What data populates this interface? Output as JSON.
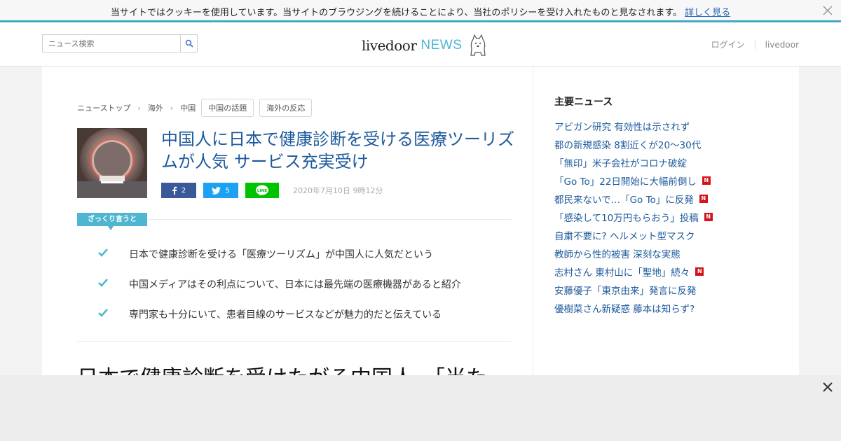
{
  "cookie": {
    "text": "当サイトではクッキーを使用しています。当サイトのブラウジングを続けることにより、当社のポリシーを受け入れたものと見なされます。",
    "link": "詳しく見る"
  },
  "header": {
    "search_placeholder": "ニュース検索",
    "logo_main": "livedoor",
    "logo_sub": "NEWS",
    "login": "ログイン",
    "livedoor": "livedoor"
  },
  "breadcrumb": [
    "ニューストップ",
    "海外",
    "中国"
  ],
  "tags": [
    "中国の話題",
    "海外の反応"
  ],
  "article": {
    "title": "中国人に日本で健康診断を受ける医療ツーリズムが人気 サービス充実受け",
    "facebook_count": "2",
    "twitter_count": "5",
    "date": "2020年7月10日 9時12分",
    "summary_label": "ざっくり言うと",
    "points": [
      "日本で健康診断を受ける「医療ツーリズム」が中国人に人気だという",
      "中国メディアはその利点について、日本には最先端の医療機器があると紹介",
      "専門家も十分にいて、患者目線のサービスなどが魅力的だと伝えている"
    ],
    "headline": "日本で健康診断を受けたがる中国人、「当た"
  },
  "sidebar": {
    "heading": "主要ニュース",
    "items": [
      {
        "text": "アビガン研究 有効性は示されず",
        "new": false
      },
      {
        "text": "都の新規感染 8割近くが20～30代",
        "new": false
      },
      {
        "text": "「無印」米子会社がコロナ破綻",
        "new": false
      },
      {
        "text": "「Go To」22日開始に大幅前倒し",
        "new": true
      },
      {
        "text": "都民来ないで…「Go To」に反発",
        "new": true
      },
      {
        "text": "「感染して10万円もらおう」投稿",
        "new": true
      },
      {
        "text": "自粛不要に? ヘルメット型マスク",
        "new": false
      },
      {
        "text": "教師から性的被害 深刻な実態",
        "new": false
      },
      {
        "text": "志村さん 東村山に「聖地」続々",
        "new": true
      },
      {
        "text": "安藤優子「東京由来」発言に反発",
        "new": false
      },
      {
        "text": "優樹菜さん新疑惑 藤本は知らず?",
        "new": false
      }
    ],
    "badge": "N"
  },
  "colors": {
    "accent": "#4fb6d2",
    "link": "#1d5a9c",
    "facebook": "#3b5998",
    "twitter": "#1da1f2",
    "line": "#00c300",
    "badge": "#d4141c"
  }
}
